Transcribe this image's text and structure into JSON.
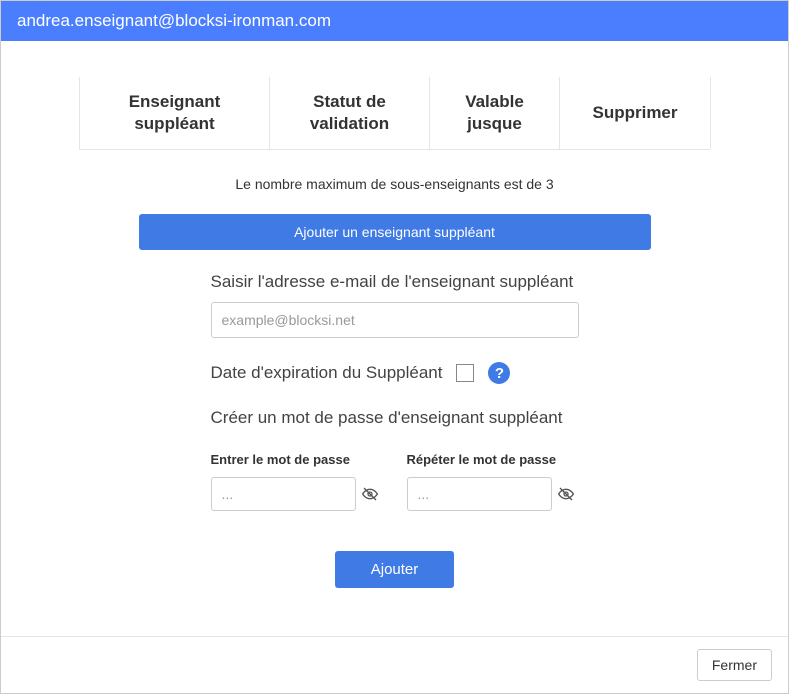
{
  "header": {
    "email": "andrea.enseignant@blocksi-ironman.com"
  },
  "table": {
    "columns": {
      "c1": "Enseignant suppléant",
      "c2": "Statut de validation",
      "c3": "Valable jusque",
      "c4": "Supprimer"
    }
  },
  "info_text": "Le nombre maximum de sous-enseignants est de 3",
  "add_button_label": "Ajouter un enseignant suppléant",
  "form": {
    "email_label": "Saisir l'adresse e-mail de l'enseignant suppléant",
    "email_placeholder": "example@blocksi.net",
    "expiration_label": "Date d'expiration du Suppléant",
    "help_glyph": "?",
    "password_section_label": "Créer un mot de passe d'enseignant suppléant",
    "password_label": "Entrer le mot de passe",
    "password_repeat_label": "Répéter le mot de passe",
    "password_placeholder": "...",
    "submit_label": "Ajouter"
  },
  "footer": {
    "close_label": "Fermer"
  }
}
